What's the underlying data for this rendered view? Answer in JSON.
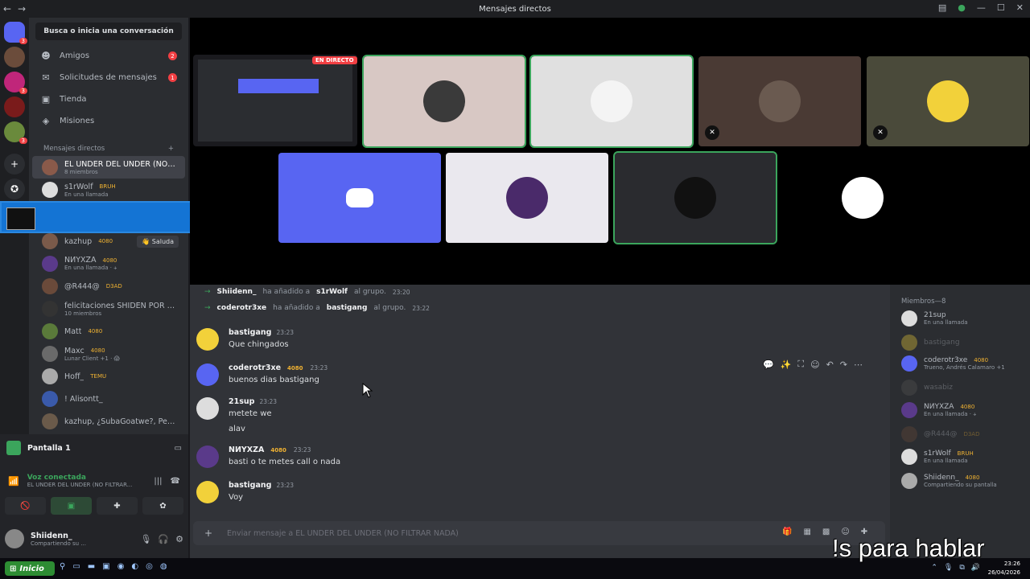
{
  "window": {
    "title": "Mensajes directos",
    "back": "←",
    "forward": "→",
    "min": "—",
    "max": "☐",
    "close": "✕"
  },
  "servers": [
    {
      "icon": "discord-icon",
      "badge": "3",
      "color": "#5865f2"
    },
    {
      "icon": "avatar",
      "badge": "",
      "color": "#6b4c3b"
    },
    {
      "icon": "checker-server-icon",
      "badge": "3",
      "color": "#c0267a"
    },
    {
      "icon": "server-red",
      "badge": "",
      "color": "#7a1b1b"
    },
    {
      "icon": "server-meme",
      "badge": "3",
      "color": "#6a8a3c"
    },
    {
      "icon": "plus-icon",
      "badge": "",
      "color": "#2b2d31",
      "glyph": "+"
    },
    {
      "icon": "compass-icon",
      "badge": "",
      "color": "#2b2d31",
      "glyph": "✪"
    }
  ],
  "sidebar": {
    "search": "Busca o inicia una conversación",
    "nav": [
      {
        "label": "Amigos",
        "icon": "friends-icon",
        "glyph": "☻",
        "count": "2"
      },
      {
        "label": "Solicitudes de mensajes",
        "icon": "mail-icon",
        "glyph": "✉",
        "count": "1"
      },
      {
        "label": "Tienda",
        "icon": "shop-icon",
        "glyph": "▣",
        "count": ""
      },
      {
        "label": "Misiones",
        "icon": "quest-icon",
        "glyph": "◈",
        "count": ""
      }
    ],
    "dm_header": "Mensajes directos",
    "dm_add": "+",
    "dms": [
      {
        "name": "EL UNDER DEL UNDER (NO ...",
        "sub": "8 miembros",
        "tag": "",
        "selected": true,
        "color": "#8a5a4a"
      },
      {
        "name": "s1rWolf",
        "sub": "En una llamada",
        "tag": "BRUH",
        "selected": false,
        "color": "#ddd"
      },
      {
        "name": "kazhup",
        "sub": "",
        "tag": "4080",
        "extra": "👋 Saluda",
        "selected": false,
        "color": "#7a5a4a"
      },
      {
        "name": "NИYXZA",
        "sub": "En una llamada · 🕂",
        "tag": "4080",
        "selected": false,
        "color": "#5a3a8a"
      },
      {
        "name": "@R444@",
        "sub": "",
        "tag": "D3AD",
        "selected": false,
        "color": "#6a4a3a"
      },
      {
        "name": "felicitaciones SHIDEN POR G...",
        "sub": "10 miembros",
        "tag": "",
        "selected": false,
        "color": "#333"
      },
      {
        "name": "Matt",
        "sub": "",
        "tag": "4080",
        "selected": false,
        "color": "#5a7a3a"
      },
      {
        "name": "Maxc",
        "sub": "Lunar Client +1 · 😱",
        "tag": "4080",
        "selected": false,
        "color": "#6a6a6a"
      },
      {
        "name": "Hoff_",
        "sub": "",
        "tag": "TEMU",
        "selected": false,
        "color": "#aaa"
      },
      {
        "name": "! Alisontt_",
        "sub": "",
        "tag": "",
        "selected": false,
        "color": "#3a5aaa"
      },
      {
        "name": "kazhup, ¿SubaGoatwe?, Pepe...",
        "sub": "",
        "tag": "",
        "selected": false,
        "color": "#6a5a4a"
      }
    ]
  },
  "voice": {
    "screen_share": "Pantalla 1",
    "status": "Voz conectada",
    "channel": "EL UNDER DEL UNDER (NO FILTRAR...",
    "user": "Shiidenn_",
    "user_sub": "Compartiendo su ..."
  },
  "stream": {
    "live_badge": "EN DIRECTO",
    "tiles": [
      {
        "kind": "screen",
        "bg": "#1a1a1e"
      },
      {
        "kind": "avatar",
        "bg": "#d8c8c4",
        "circle": "#3a3a3a",
        "speaking": true,
        "muted": false
      },
      {
        "kind": "avatar",
        "bg": "#e0e0e0",
        "circle": "#f4f4f4",
        "speaking": true,
        "muted": false
      },
      {
        "kind": "avatar",
        "bg": "#4a3a34",
        "circle": "#6a5a50",
        "speaking": false,
        "muted": true
      },
      {
        "kind": "avatar",
        "bg": "#4a4a3a",
        "circle": "#f2d13a",
        "speaking": false,
        "muted": true
      },
      {
        "kind": "avatar",
        "bg": "#5865f2",
        "circle": "#5865f2",
        "speaking": false,
        "muted": false,
        "discord": true
      },
      {
        "kind": "avatar",
        "bg": "#eae8ee",
        "circle": "#4a2a6a",
        "speaking": false,
        "muted": false
      },
      {
        "kind": "avatar",
        "bg": "#2a2b2f",
        "circle": "#111111",
        "speaking": true,
        "muted": false
      },
      {
        "kind": "avatar",
        "bg": "#000000",
        "circle": "#ffffff",
        "speaking": false,
        "muted": false
      }
    ]
  },
  "chat": {
    "system": [
      {
        "actor": "Shiidenn_",
        "text": "ha añadido a",
        "target": "s1rWolf",
        "tail": "al grupo.",
        "time": "23:20"
      },
      {
        "actor": "coderotr3xe",
        "text": "ha añadido a",
        "target": "bastigang",
        "tail": "al grupo.",
        "time": "23:22"
      }
    ],
    "messages": [
      {
        "author": "bastigang",
        "badge": "",
        "time": "23:23",
        "lines": [
          "Que chingados"
        ],
        "color": "#f2d13a"
      },
      {
        "author": "coderotr3xe",
        "badge": "4080",
        "time": "23:23",
        "lines": [
          "buenos dias bastigang"
        ],
        "color": "#5865f2"
      },
      {
        "author": "21sup",
        "badge": "",
        "time": "23:23",
        "lines": [
          "metete we",
          "alav"
        ],
        "color": "#ddd"
      },
      {
        "author": "NИYXZA",
        "badge": "4080",
        "time": "23:23",
        "lines": [
          "basti o te metes call o nada"
        ],
        "color": "#5a3a8a"
      },
      {
        "author": "bastigang",
        "badge": "",
        "time": "23:23",
        "lines": [
          "Voy"
        ],
        "color": "#f2d13a"
      }
    ],
    "composer_placeholder": "Enviar mensaje a EL UNDER DEL UNDER (NO FILTRAR NADA)",
    "tools": [
      "💬",
      "✨",
      "⛶",
      "☺",
      "↶",
      "↷",
      "⋯"
    ]
  },
  "members": {
    "header": "Miembros—8",
    "list": [
      {
        "name": "21sup",
        "sub": "En una llamada",
        "tag": "",
        "color": "#ddd"
      },
      {
        "name": "bastigang",
        "sub": "",
        "tag": "",
        "color": "#f2d13a"
      },
      {
        "name": "coderotr3xe",
        "sub": "Trueno, Andrés Calamaro +1",
        "tag": "4080",
        "color": "#5865f2"
      },
      {
        "name": "wasabiz",
        "sub": "",
        "tag": "",
        "color": "#555"
      },
      {
        "name": "NИYXZA",
        "sub": "En una llamada · 🕂",
        "tag": "4080",
        "color": "#5a3a8a"
      },
      {
        "name": "@R444@",
        "sub": "",
        "tag": "D3AD",
        "color": "#6a4a3a"
      },
      {
        "name": "s1rWolf",
        "sub": "En una llamada",
        "tag": "BRUH",
        "color": "#ddd"
      },
      {
        "name": "Shiidenn_",
        "sub": "Compartiendo su pantalla",
        "tag": "4080",
        "color": "#aaa"
      }
    ]
  },
  "taskbar": {
    "start": "Inicio",
    "time": "23:26",
    "date": "26/04/2026"
  },
  "caption": "!s para hablar"
}
